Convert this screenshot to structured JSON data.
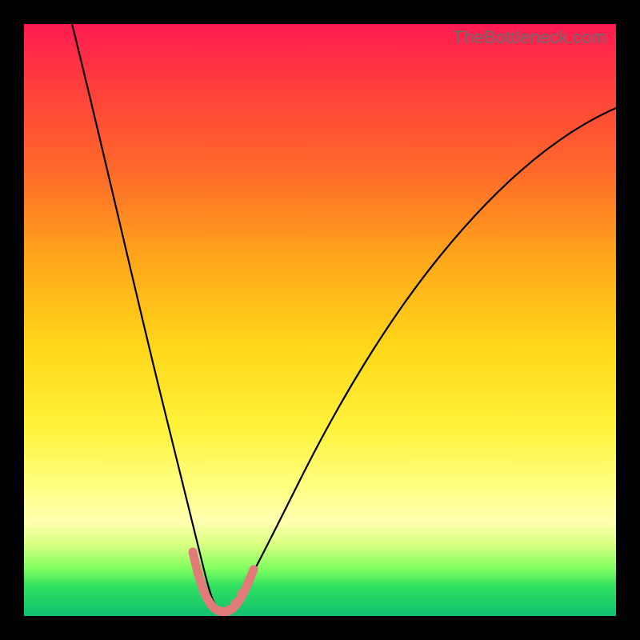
{
  "watermark": "TheBottleneck.com",
  "colors": {
    "background": "#000000",
    "gradient_top": "#ff1a52",
    "gradient_bottom": "#10c070",
    "curve": "#000000",
    "highlight": "#e27a7a"
  },
  "chart_data": {
    "type": "line",
    "title": "",
    "xlabel": "",
    "ylabel": "",
    "xlim": [
      0,
      100
    ],
    "ylim": [
      0,
      100
    ],
    "grid": false,
    "legend": false,
    "series": [
      {
        "name": "bottleneck-curve",
        "x": [
          0,
          5,
          10,
          15,
          20,
          23,
          26,
          28,
          30,
          32,
          34,
          36,
          40,
          45,
          50,
          55,
          60,
          65,
          70,
          75,
          80,
          85,
          90,
          95,
          100
        ],
        "y": [
          100,
          84,
          67,
          50,
          33,
          22,
          12,
          6,
          2,
          0,
          0,
          2,
          8,
          18,
          28,
          37,
          45,
          52,
          58,
          64,
          69,
          73,
          77,
          80,
          83
        ]
      }
    ],
    "highlight_region": {
      "x": [
        27.5,
        28.3,
        29.2,
        30.1,
        31.0,
        31.9,
        32.8,
        33.7,
        34.6,
        35.4,
        36.1
      ],
      "y": [
        8.5,
        5.3,
        2.9,
        1.3,
        0.4,
        0.2,
        0.7,
        1.9,
        3.7,
        6.0,
        8.7
      ]
    },
    "minimum_point": {
      "x": 31.5,
      "y": 0
    }
  }
}
